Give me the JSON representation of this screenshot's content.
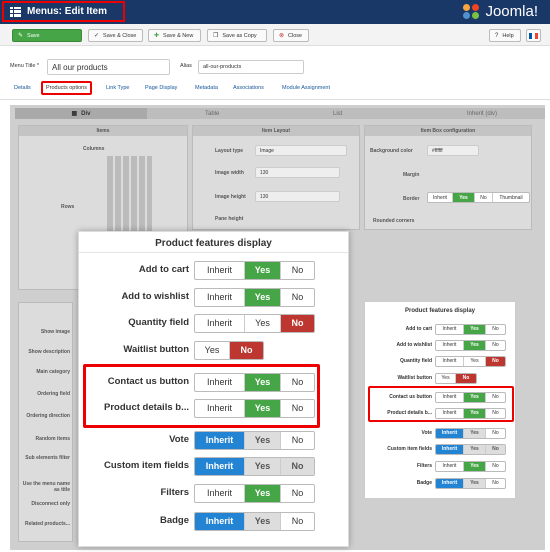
{
  "header": {
    "title": "Menus: Edit Item",
    "logo_text": "Joomla!"
  },
  "toolbar": {
    "save": "Save",
    "save_close": "Save & Close",
    "save_new": "Save & New",
    "save_copy": "Save as Copy",
    "close": "Close",
    "help": "Help"
  },
  "form": {
    "menu_title_label": "Menu Title *",
    "menu_title_value": "All our products",
    "alias_label": "Alias",
    "alias_value": "all-our-products"
  },
  "tabs": [
    "Details",
    "Products options",
    "Link Type",
    "Page Display",
    "Metadata",
    "Associations",
    "Module Assignment"
  ],
  "subtabs": [
    "Div",
    "Table",
    "List",
    "Inherit (div)"
  ],
  "panels": {
    "items": {
      "title": "Items",
      "columns": "Columns",
      "rows": "Rows"
    },
    "item_layout": {
      "title": "Item Layout",
      "layout_type": "Layout type",
      "layout_value": "Image",
      "image_width": "Image width",
      "image_width_val": "130",
      "image_height": "Image height",
      "image_height_val": "130",
      "pane_height": "Pane height",
      "px": "px"
    },
    "item_box": {
      "title": "Item Box configuration",
      "bg_color": "Background color",
      "bg_value": "#ffffff",
      "margin": "Margin",
      "border": "Border",
      "rounded": "Rounded corners",
      "border_opts": [
        "Inherit",
        "Yes",
        "No",
        "Thumbnail"
      ],
      "rounded_opts": [
        "Inherit",
        "Yes",
        "No"
      ]
    }
  },
  "left_list": [
    "Show image",
    "Show description",
    "Main category",
    "Ordering field",
    "Ordering direction",
    "Random items",
    "Sub elements filter",
    "Use the menu name as title",
    "Disconnect only",
    "Related products..."
  ],
  "features": {
    "title": "Product features display",
    "rows": [
      {
        "label": "Add to cart",
        "options": [
          "Inherit",
          "Yes",
          "No"
        ],
        "active": 1
      },
      {
        "label": "Add to wishlist",
        "options": [
          "Inherit",
          "Yes",
          "No"
        ],
        "active": 1
      },
      {
        "label": "Quantity field",
        "options": [
          "Inherit",
          "Yes",
          "No"
        ],
        "active": 2
      },
      {
        "label": "Waitlist button",
        "options": [
          "Yes",
          "No"
        ],
        "active": 1
      },
      {
        "label": "Contact us button",
        "options": [
          "Inherit",
          "Yes",
          "No"
        ],
        "active": 1
      },
      {
        "label": "Product details b...",
        "options": [
          "Inherit",
          "Yes",
          "No"
        ],
        "active": 1
      },
      {
        "label": "Vote",
        "options": [
          "Inherit",
          "Yes",
          "No"
        ],
        "active": 0
      },
      {
        "label": "Custom item fields",
        "options": [
          "Inherit",
          "Yes",
          "No"
        ],
        "active": 0
      },
      {
        "label": "Filters",
        "options": [
          "Inherit",
          "Yes",
          "No"
        ],
        "active": 1
      },
      {
        "label": "Badge",
        "options": [
          "Inherit",
          "Yes",
          "No"
        ],
        "active": 0
      }
    ]
  },
  "colors": {
    "header": "#1a3867",
    "green": "#46a546",
    "red": "#bd362f",
    "blue": "#2384d3",
    "highlight": "#ee0000"
  }
}
